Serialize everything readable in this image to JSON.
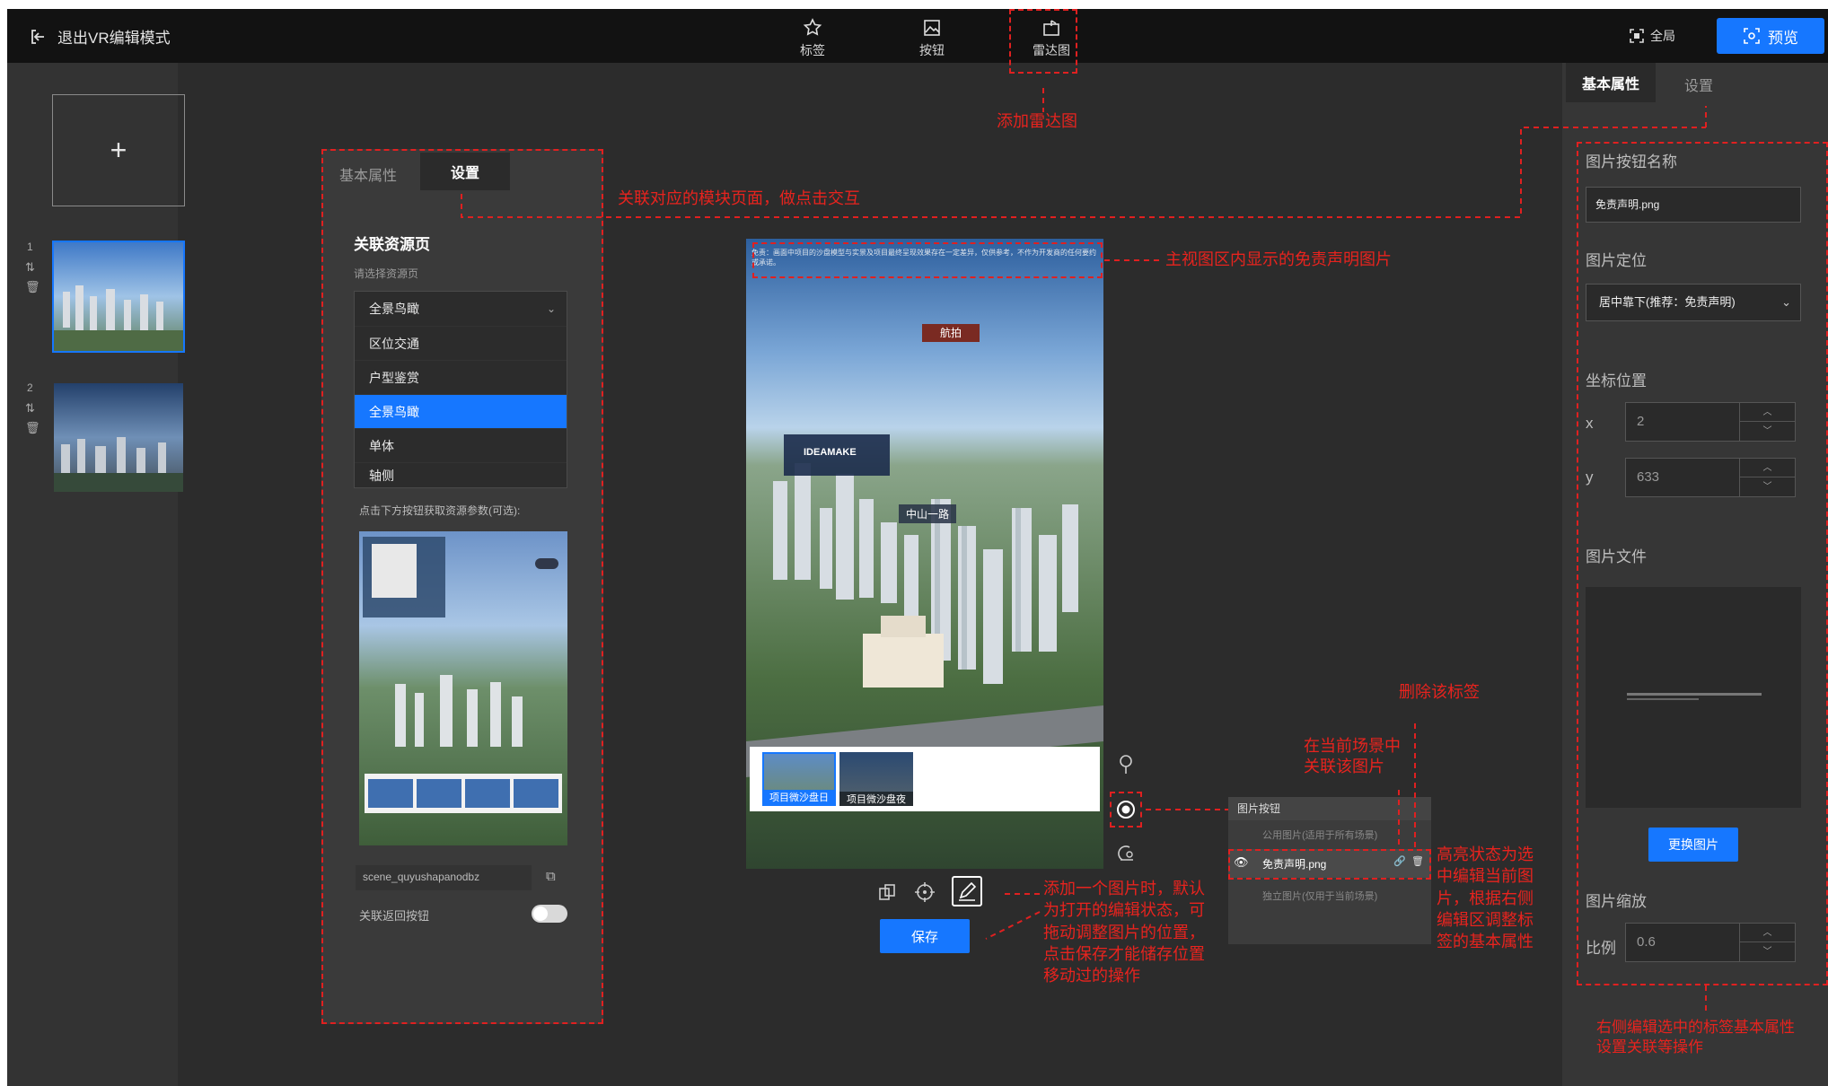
{
  "topbar": {
    "exit_label": "退出VR编辑模式",
    "tools": [
      {
        "label": "标签",
        "icon": "pin-star-icon"
      },
      {
        "label": "按钮",
        "icon": "image-button-icon"
      },
      {
        "label": "雷达图",
        "icon": "radar-map-icon"
      }
    ],
    "fullscreen_label": "全局",
    "preview_label": "预览"
  },
  "scene_list": {
    "add_symbol": "+",
    "items": [
      {
        "index": "1",
        "selected": true
      },
      {
        "index": "2",
        "selected": false
      }
    ]
  },
  "middle_panel": {
    "tabs": [
      "基本属性",
      "设置"
    ],
    "active_tab": "设置",
    "section_title": "关联资源页",
    "select_hint": "请选择资源页",
    "selected_value": "全景鸟瞰",
    "options": [
      "区位交通",
      "户型鉴赏",
      "全景鸟瞰",
      "单体",
      "轴侧"
    ],
    "highlight_option": "全景鸟瞰",
    "param_hint": "点击下方按钮获取资源参数(可选):",
    "scene_id": "scene_quyushapanodbz",
    "return_toggle_label": "关联返回按钮",
    "return_toggle_on": false
  },
  "preview": {
    "disclaimer_text": "免责：画面中项目的沙盘模型与实景及项目最终呈现效果存在一定差异，仅供参考，不作为开发商的任何要约或承诺。",
    "hotspot_1": "航拍",
    "hotspot_2": "中山一路",
    "logo_text": "IDEAMAKE",
    "bottom_thumbs": [
      "项目微沙盘日",
      "项目微沙盘夜"
    ],
    "save_label": "保存"
  },
  "layer_popup": {
    "header": "图片按钮",
    "items": [
      {
        "label": "公用图片(适用于所有场景)",
        "highlight": false
      },
      {
        "label": "免责声明.png",
        "highlight": true
      },
      {
        "label": "独立图片(仅用于当前场景)",
        "highlight": false
      }
    ]
  },
  "right_panel": {
    "tabs": [
      "基本属性",
      "设置"
    ],
    "active_tab": "基本属性",
    "name_label": "图片按钮名称",
    "name_value": "免责声明.png",
    "position_label": "图片定位",
    "position_value": "居中靠下(推荐：免责声明)",
    "coord_label": "坐标位置",
    "x_label": "x",
    "x_value": "2",
    "y_label": "y",
    "y_value": "633",
    "file_label": "图片文件",
    "replace_label": "更换图片",
    "scale_section": "图片缩放",
    "scale_label": "比例",
    "scale_value": "0.6"
  },
  "annotations": {
    "add_radar": "添加雷达图",
    "link_module": "关联对应的模块页面，做点击交互",
    "disclaimer_note": "主视图区内显示的免责声明图片",
    "delete_tag": "删除该标签",
    "link_image": "在当前场景中\n关联该图片",
    "highlight_note": "高亮状态为选\n中编辑当前图\n片，根据右侧\n编辑区调整标\n签的基本属性",
    "add_image_note": "添加一个图片时，默认\n为打开的编辑状态，可\n拖动调整图片的位置，\n点击保存才能储存位置\n移动过的操作",
    "right_note": "右侧编辑选中的标签基本属性\n设置关联等操作"
  },
  "colors": {
    "accent": "#1677ff",
    "annotation_red": "#e8231e",
    "background": "#2c2c2c",
    "topbar": "#121212"
  }
}
